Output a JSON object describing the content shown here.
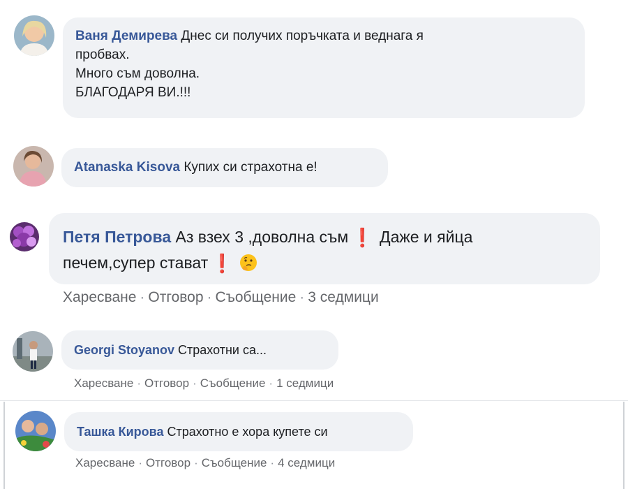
{
  "comments": [
    {
      "author": "Ваня Демирева",
      "text": "Днес си получих поръчката и веднага я",
      "lines": [
        "пробвах.",
        "Много съм доволна.",
        "БЛАГОДАРЯ ВИ.!!!"
      ]
    },
    {
      "author": "Atanaska Kisova",
      "text": "Купих си страхотна е!"
    },
    {
      "author": "Петя Петрова",
      "text": "Аз взех 3 ,доволна съм",
      "text2": "Даже и яйца",
      "line2": "печем,супер стават",
      "emoji_exclamation": "❗",
      "emoji_thinking": "thinking-face-icon",
      "actions": {
        "like": "Харесване",
        "reply": "Отговор",
        "message": "Съобщение",
        "time": "3 седмици",
        "sep": "·"
      }
    },
    {
      "author": "Georgi Stoyanov",
      "text": "Страхотни са...",
      "actions": {
        "like": "Харесване",
        "reply": "Отговор",
        "message": "Съобщение",
        "time": "1 седмици",
        "sep": "·"
      }
    },
    {
      "author": "Ташка Кирова",
      "text": "Страхотно е хора купете си",
      "actions": {
        "like": "Харесване",
        "reply": "Отговор",
        "message": "Съобщение",
        "time": "4 седмици",
        "sep": "·"
      }
    }
  ],
  "colors": {
    "bubble": "#f0f2f5",
    "author": "#385898",
    "meta": "#65676b",
    "exclamation": "#e02f2f"
  }
}
